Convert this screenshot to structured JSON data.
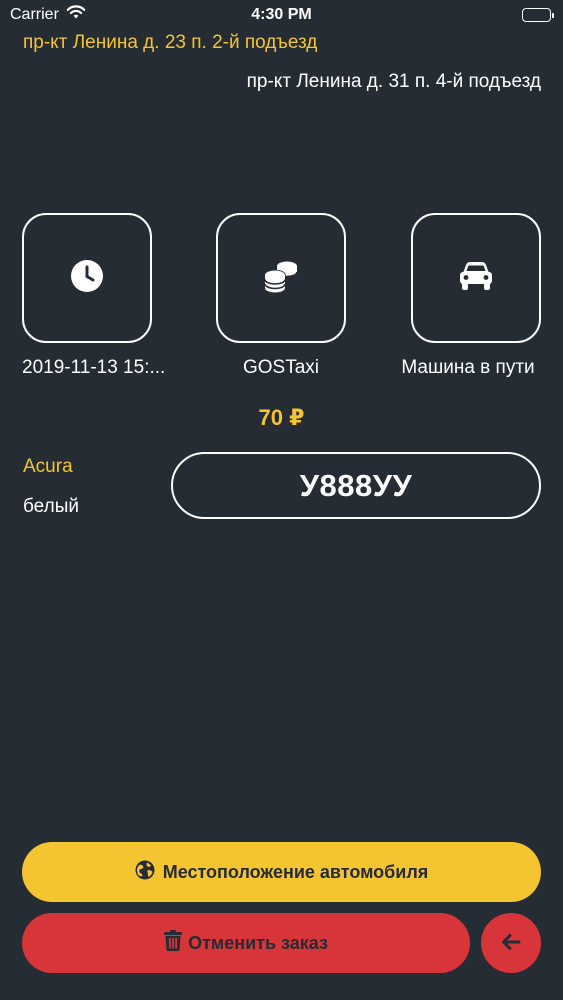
{
  "status_bar": {
    "carrier": "Carrier",
    "time": "4:30 PM"
  },
  "route": {
    "from": "пр-кт Ленина д. 23 п. 2-й подъезд",
    "to": "пр-кт Ленина д. 31 п. 4-й подъезд"
  },
  "tiles": [
    {
      "icon": "clock-icon",
      "caption": "2019-11-13 15:..."
    },
    {
      "icon": "coins-icon",
      "caption": "GOSTaxi"
    },
    {
      "icon": "car-icon",
      "caption": "Машина в пути"
    }
  ],
  "price": "70 ₽",
  "car": {
    "brand": "Acura",
    "color": "белый",
    "plate": "У888УУ"
  },
  "actions": {
    "location_label": "Местоположение автомобиля",
    "location_icon": "globe-icon",
    "cancel_label": "Отменить заказ",
    "cancel_icon": "trash-icon",
    "back_icon": "arrow-left-icon"
  },
  "colors": {
    "background": "#262c33",
    "accent": "#f5c431",
    "danger": "#d8353b",
    "text": "#ffffff"
  }
}
